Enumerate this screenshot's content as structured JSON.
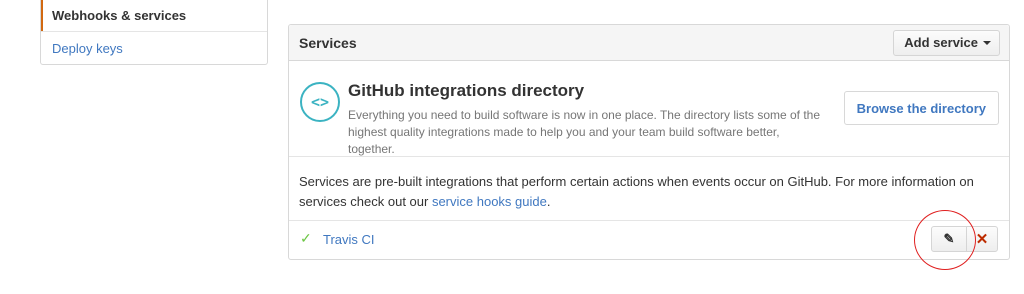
{
  "sidebar": {
    "items": [
      {
        "label": "Webhooks & services",
        "active": true
      },
      {
        "label": "Deploy keys",
        "active": false
      }
    ],
    "active_color": "#d26911"
  },
  "services": {
    "title": "Services",
    "add_service_label": "Add service",
    "integrations": {
      "icon": "code-brackets-icon",
      "icon_glyph": "<>",
      "title": "GitHub integrations directory",
      "description": "Everything you need to build software is now in one place. The directory lists some of the highest quality integrations made to help you and your team build software better, together.",
      "browse_label": "Browse the directory"
    },
    "info": {
      "text_before": "Services are pre-built integrations that perform certain actions when events occur on GitHub. For more information on services check out our ",
      "link_text": "service hooks guide",
      "text_after": "."
    },
    "list": [
      {
        "name": "Travis CI",
        "status_icon": "check-icon",
        "status_glyph": "✓",
        "edit_icon": "pencil-icon",
        "edit_glyph": "✎",
        "delete_icon": "close-icon",
        "delete_glyph": "✕"
      }
    ]
  },
  "colors": {
    "link": "#4078c0",
    "accent": "#3bb3c2",
    "success": "#6cc644",
    "danger": "#bd2c00",
    "annotation": "#e02020"
  }
}
